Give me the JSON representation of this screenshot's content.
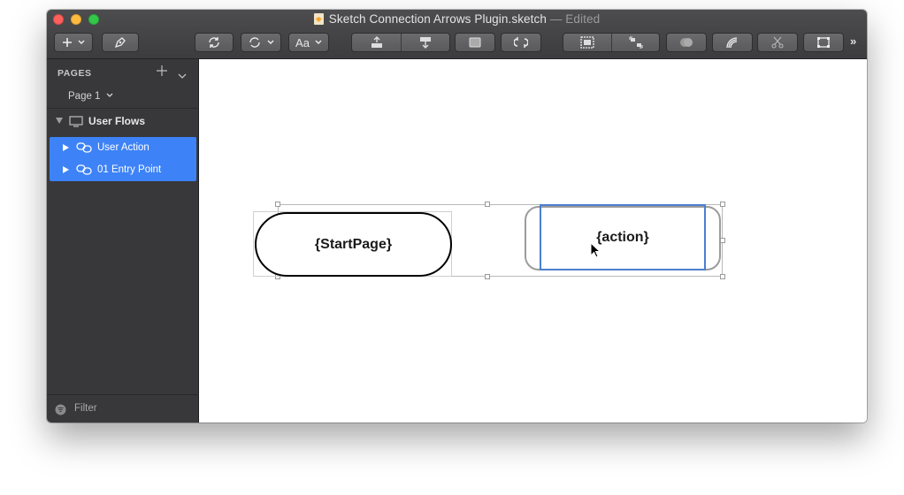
{
  "window": {
    "title": "Sketch Connection Arrows Plugin.sketch",
    "title_suffix": "— Edited"
  },
  "toolbar": {
    "insert_icon": "plus-icon",
    "edit_icon": "pen-icon",
    "text_style_label": "Aa",
    "more_label": "»"
  },
  "sidebar": {
    "pages_header": "PAGES",
    "current_page": "Page 1",
    "artboard": {
      "label": "User Flows",
      "icon": "screen-icon"
    },
    "layers": [
      {
        "label": "User Action",
        "icon": "link-icon",
        "selected": true
      },
      {
        "label": "01 Entry Point",
        "icon": "link-icon",
        "selected": true
      }
    ],
    "filter_label": "Filter",
    "selection_color": "#3d82f7"
  },
  "canvas": {
    "start_node": {
      "label": "{StartPage}"
    },
    "action_node": {
      "label": "{action}"
    }
  }
}
